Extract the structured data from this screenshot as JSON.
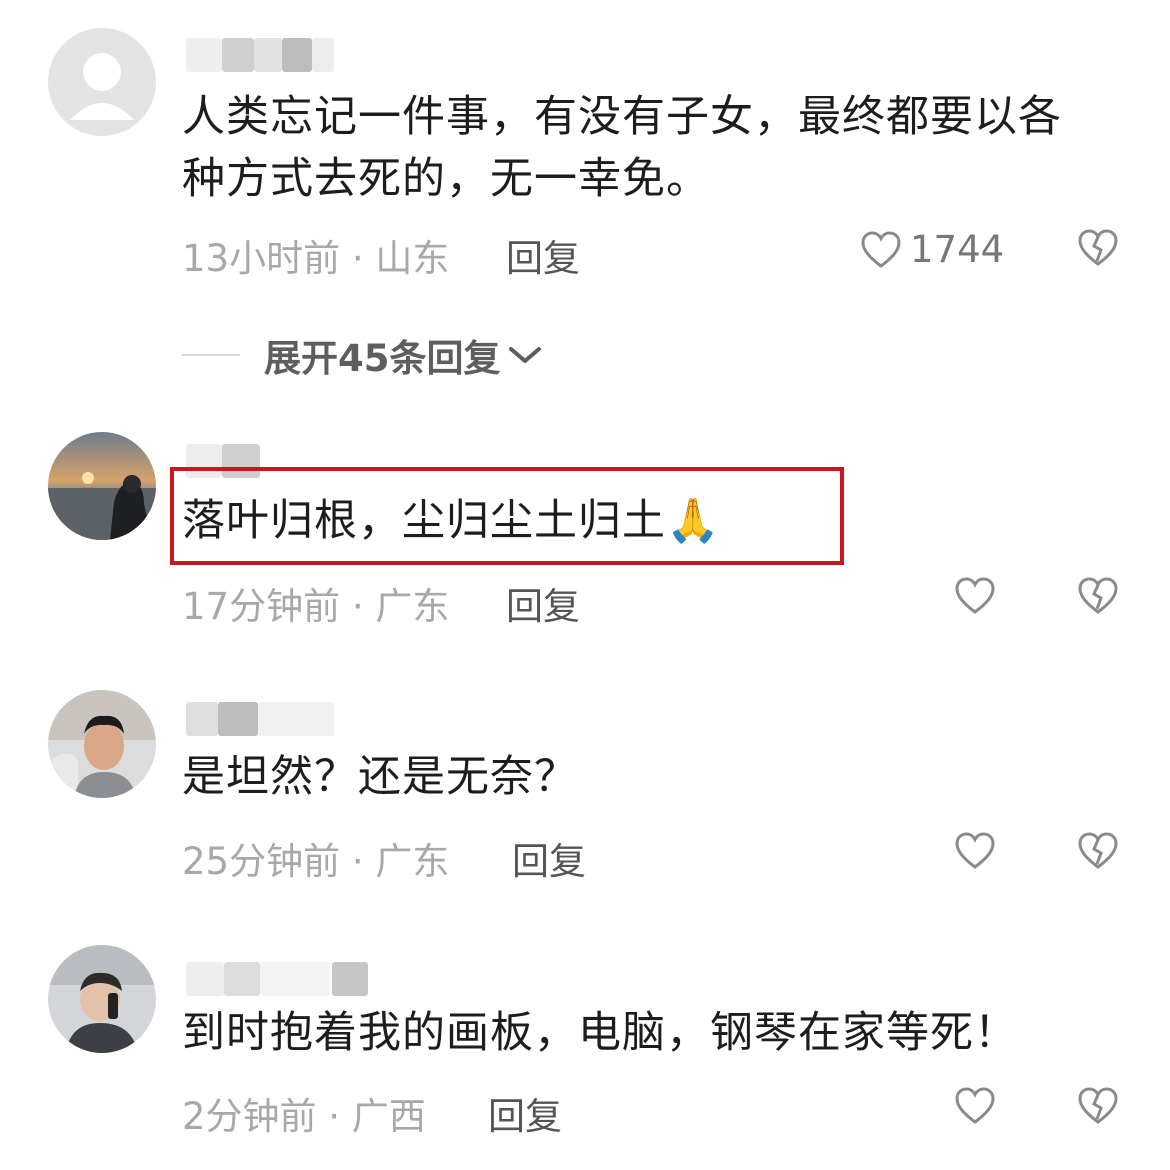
{
  "comments": [
    {
      "text_lines": [
        "人类忘记一件事，有没有子女，最终都要以各",
        "种方式去死的，无一幸免。"
      ],
      "time": "13小时前",
      "location": "山东",
      "reply_label": "回复",
      "likes": "1744",
      "avatar_icon": "default-user-avatar"
    },
    {
      "text_lines": [
        "落叶归根，尘归尘土归土🙏"
      ],
      "time": "17分钟前",
      "location": "广东",
      "reply_label": "回复",
      "likes": "",
      "avatar_icon": "sunset-beach-photo-avatar"
    },
    {
      "text_lines": [
        "是坦然？还是无奈？"
      ],
      "time": "25分钟前",
      "location": "广东",
      "reply_label": "回复",
      "likes": "",
      "avatar_icon": "man-selfie-avatar"
    },
    {
      "text_lines": [
        "到时抱着我的画板，电脑，钢琴在家等死！"
      ],
      "time": "2分钟前",
      "location": "广西",
      "reply_label": "回复",
      "likes": "",
      "avatar_icon": "person-photo-avatar"
    }
  ],
  "expand_replies": {
    "label": "展开45条回复"
  },
  "meta_separator": " · ",
  "colors": {
    "highlight_border": "#c8171d",
    "meta_gray": "#a8a8a8",
    "text": "#1d1d1d"
  }
}
